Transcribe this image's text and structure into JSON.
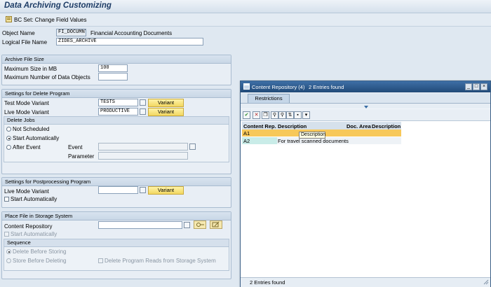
{
  "app": {
    "title": "Data Archiving Customizing",
    "toolbar_bcset": "BC Set: Change Field Values"
  },
  "header": {
    "object_name_label": "Object Name",
    "object_name_value": "FI_DOCUMNT",
    "object_name_desc": "Financial Accounting Documents",
    "logical_file_label": "Logical File Name",
    "logical_file_value": "ZIDES_ARCHIVE"
  },
  "archive_file_size": {
    "title": "Archive File Size",
    "max_size_label": "Maximum Size in MB",
    "max_size_value": "100",
    "max_objects_label": "Maximum Number of Data Objects",
    "max_objects_value": ""
  },
  "delete_program": {
    "title": "Settings for Delete Program",
    "test_mode_label": "Test Mode Variant",
    "test_mode_value": "TESTS",
    "live_mode_label": "Live Mode Variant",
    "live_mode_value": "PRODUCTIVE",
    "variant_label": "Variant",
    "delete_jobs": {
      "title": "Delete Jobs",
      "not_scheduled": "Not Scheduled",
      "start_auto": "Start Automatically",
      "after_event": "After Event",
      "event_label": "Event",
      "parameter_label": "Parameter",
      "event_value": "",
      "parameter_value": ""
    }
  },
  "postprocessing": {
    "title": "Settings for Postprocessing Program",
    "live_mode_label": "Live Mode Variant",
    "live_mode_value": "",
    "variant_label": "Variant",
    "start_auto": "Start Automatically"
  },
  "storage": {
    "title": "Place File in Storage System",
    "content_repo_label": "Content Repository",
    "content_repo_value": "",
    "start_auto": "Start Automatically",
    "sequence": {
      "title": "Sequence",
      "delete_before": "Delete Before Storing",
      "store_before": "Store Before Deleting",
      "reads_from": "Delete Program Reads from Storage System"
    }
  },
  "popup": {
    "title": "Content Repository (4)",
    "entries": "2 Entries found",
    "tab": "Restrictions",
    "columns": [
      "Content Rep.",
      "Description",
      "Doc. Area",
      "Description"
    ],
    "rows": [
      {
        "rep": "A1",
        "desc": ""
      },
      {
        "rep": "A2",
        "desc": "For travel scanned documents"
      }
    ],
    "tooltip": "Description",
    "status": "2 Entries found"
  },
  "colors": {
    "accent": "#1d3c66",
    "button": "#f2d760",
    "selected_row": "#f7c85a"
  }
}
